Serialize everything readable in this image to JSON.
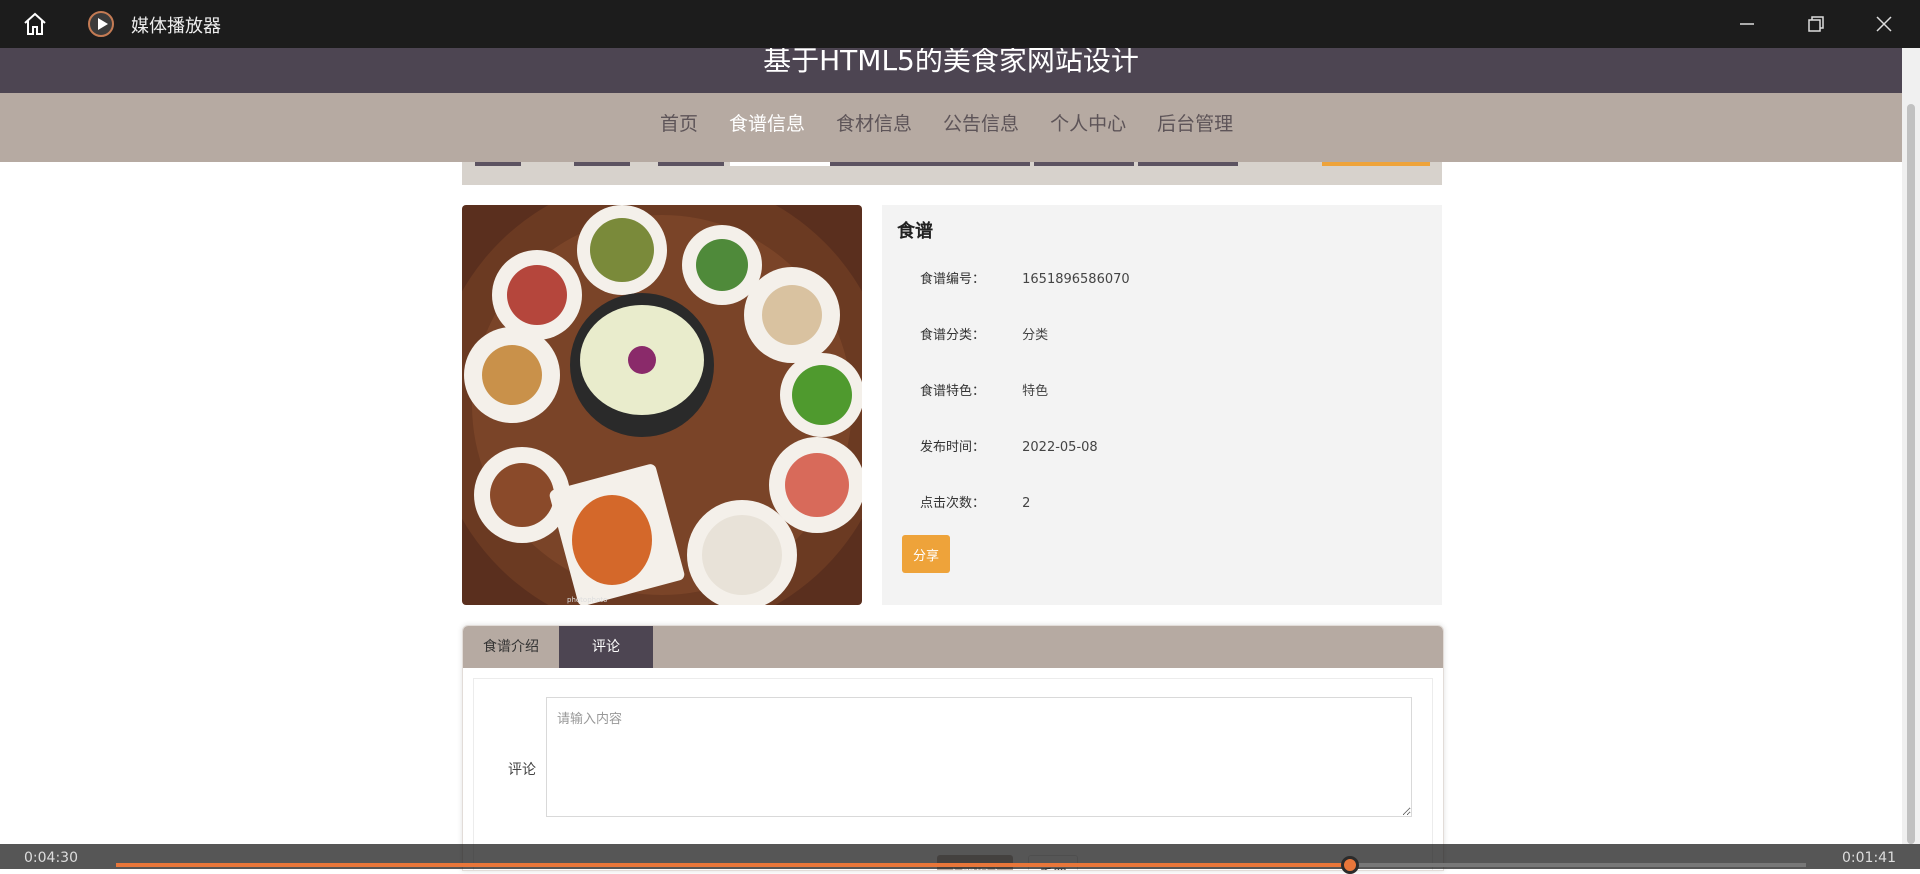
{
  "window": {
    "app_title": "媒体播放器",
    "minimize_icon": "minimize-icon",
    "maximize_icon": "restore-icon",
    "close_icon": "close-icon"
  },
  "site": {
    "title": "基于HTML5的美食家网站设计"
  },
  "nav": {
    "items": [
      "首页",
      "食谱信息",
      "食材信息",
      "公告信息",
      "个人中心",
      "后台管理"
    ],
    "active": "食谱信息"
  },
  "recipe": {
    "section_title": "食谱",
    "fields": [
      {
        "label": "食谱编号：",
        "value": "1651896586070"
      },
      {
        "label": "食谱分类：",
        "value": "分类"
      },
      {
        "label": "食谱特色：",
        "value": "特色"
      },
      {
        "label": "发布时间：",
        "value": "2022-05-08"
      },
      {
        "label": "点击次数：",
        "value": "2"
      }
    ],
    "share_label": "分享"
  },
  "tabs": {
    "items": [
      "食谱介绍",
      "评论"
    ],
    "active": "评论"
  },
  "comment_form": {
    "label": "评论",
    "placeholder": "请输入内容",
    "submit_label": "立即提交",
    "reset_label": "重置"
  },
  "player": {
    "elapsed": "0:04:30",
    "remaining": "0:01:41",
    "progress_fraction": 0.73
  },
  "colors": {
    "header_bg": "#4d4552",
    "nav_bg": "#b6aaa2",
    "accent": "#eea33a",
    "seek": "#e8763a"
  }
}
